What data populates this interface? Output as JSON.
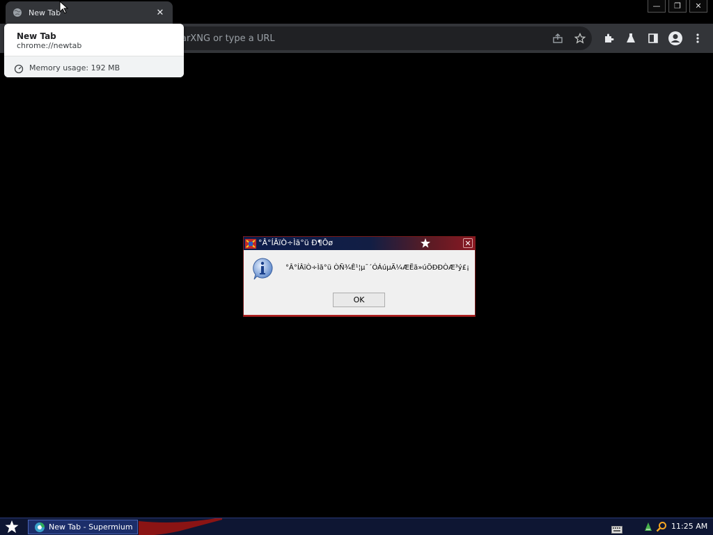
{
  "browser": {
    "tab": {
      "title": "New Tab",
      "close_label": "✕"
    },
    "omnibox": {
      "placeholder": "arXNG or type a URL"
    },
    "window_controls": {
      "minimize": "—",
      "restore": "❐",
      "close": "✕"
    },
    "icons": [
      "share-icon",
      "bookmark-star-icon",
      "extensions-icon",
      "labs-flask-icon",
      "side-panel-icon",
      "profile-icon",
      "menu-icon"
    ]
  },
  "hover_card": {
    "title": "New Tab",
    "url": "chrome://newtab",
    "memory": "Memory usage: 192 MB"
  },
  "dialog": {
    "title": "°Â°ÍÂïÒ÷Ìã°ü  Ð¶Ôø",
    "message": "°Â°ÍÂïÒ÷Ìã°ü  ÒÑ¾­Ê¹¦µ¯´ÓÁúµÄ¼ÆËã»úÖÐÐÒÆ³ý£¡",
    "ok_label": "OK",
    "close_label": "✕"
  },
  "taskbar": {
    "task_label": "New Tab - Supermium",
    "clock": "11:25 AM"
  },
  "colors": {
    "chrome_dark": "#333539",
    "omnibox_bg": "#202124",
    "taskbar_bg": "#0e1633",
    "dialog_accent": "#8a1822"
  }
}
